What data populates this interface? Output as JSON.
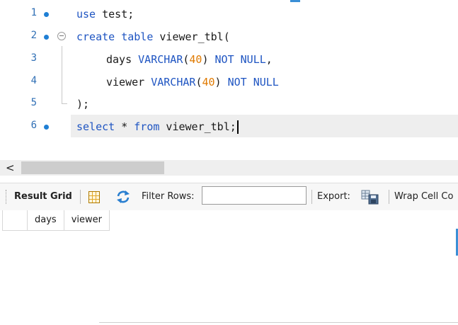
{
  "editor": {
    "lines": [
      {
        "num": "1",
        "breakpoint": true,
        "fold": false
      },
      {
        "num": "2",
        "breakpoint": true,
        "fold": true
      },
      {
        "num": "3",
        "breakpoint": false,
        "fold": false
      },
      {
        "num": "4",
        "breakpoint": false,
        "fold": false
      },
      {
        "num": "5",
        "breakpoint": false,
        "fold": false
      },
      {
        "num": "6",
        "breakpoint": true,
        "fold": false
      }
    ],
    "code": {
      "l1": {
        "kw": "use",
        "text": " test;"
      },
      "l2": {
        "kw1": "create",
        "kw2": "table",
        "text": " viewer_tbl("
      },
      "l3": {
        "name": "days",
        "type": "VARCHAR",
        "open": "(",
        "size": "40",
        "close": ")",
        "constraint": "NOT NULL",
        "tail": ","
      },
      "l4": {
        "name": "viewer",
        "type": "VARCHAR",
        "open": "(",
        "size": "40",
        "close": ")",
        "constraint": "NOT NULL",
        "tail": ""
      },
      "l5": {
        "text": ");"
      },
      "l6": {
        "kw1": "select",
        "star": " * ",
        "kw2": "from",
        "text": " viewer_tbl;"
      }
    },
    "colors": {
      "keyword": "#1f55c2",
      "number": "#e07a00",
      "line_number": "#2f6fb5"
    }
  },
  "scrollbar": {
    "left_arrow": "<"
  },
  "toolbar": {
    "result_grid_label": "Result Grid",
    "grid_icon": "grid-layout-icon",
    "refresh_icon": "refresh-icon",
    "filter_label": "Filter Rows:",
    "filter_value": "",
    "export_label": "Export:",
    "export_icon": "export-save-icon",
    "wrap_label": "Wrap Cell Co"
  },
  "grid": {
    "columns": [
      "days",
      "viewer"
    ],
    "rows": []
  }
}
